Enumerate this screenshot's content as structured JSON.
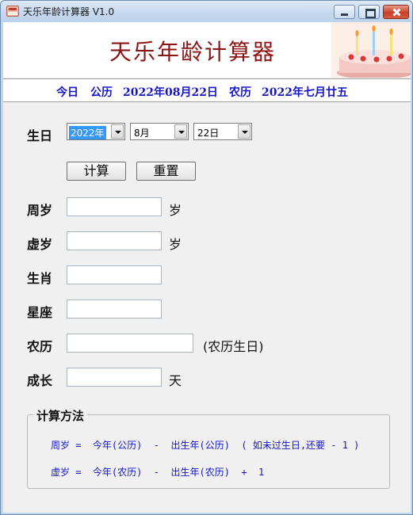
{
  "window": {
    "title": "天乐年龄计算器 V1.0"
  },
  "banner": {
    "heading": "天乐年龄计算器"
  },
  "datebar": {
    "today_label": "今日",
    "gregorian_label": "公历",
    "gregorian_date": "2022年08月22日",
    "lunar_label": "农历",
    "lunar_date": "2022年七月廿五"
  },
  "form": {
    "birthday_label": "生日",
    "year_select": "2022年",
    "month_select": "8月",
    "day_select": "22日",
    "calc_button": "计算",
    "reset_button": "重置",
    "fields": [
      {
        "label": "周岁",
        "unit": "岁"
      },
      {
        "label": "虚岁",
        "unit": "岁"
      },
      {
        "label": "生肖",
        "unit": ""
      },
      {
        "label": "星座",
        "unit": ""
      },
      {
        "label": "农历",
        "unit": "(农历生日)"
      },
      {
        "label": "成长",
        "unit": "天"
      }
    ]
  },
  "method": {
    "title": "计算方法",
    "formula1": "周岁 =  今年(公历)  -  出生年(公历)  ( 如未过生日,还要 - 1 )",
    "formula2": "虚岁 =  今年(农历)  -  出生年(农历)  +  1"
  },
  "colors": {
    "heading": "#8b1414",
    "datebar_text": "#1515c8",
    "formula_text": "#1515c8"
  }
}
